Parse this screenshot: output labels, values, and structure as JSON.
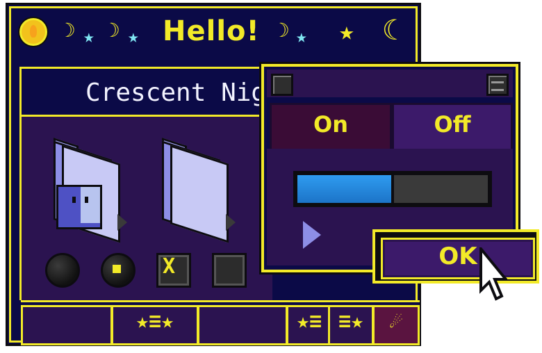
{
  "title_bar": {
    "title": "Hello!",
    "left_decorations": [
      "☽",
      "★",
      "☽",
      "★"
    ],
    "right_decorations": [
      "☽",
      "★",
      "★",
      "☾"
    ]
  },
  "panel": {
    "header": "Crescent Night"
  },
  "desktop_icons": [
    {
      "icon": "finder-folder-icon"
    },
    {
      "icon": "folder-icon"
    }
  ],
  "controls": {
    "radio_off": false,
    "radio_on": true,
    "checkbox_checked": true,
    "checkbox_unchecked": false,
    "check_glyph": "X"
  },
  "dialog": {
    "segments": [
      {
        "label": "On",
        "selected": true
      },
      {
        "label": "Off",
        "selected": false
      }
    ],
    "progress": 0.5,
    "ok_label": "OK"
  },
  "bottom_bar": {
    "cells": [
      "",
      "★≡★",
      "",
      "★≡",
      "≡★",
      "☄"
    ]
  },
  "colors": {
    "navy": "#0b0a47",
    "purple": "#2b1350",
    "yellow": "#f2ea28",
    "cyan": "#7fe6f2",
    "blue_fill": "#2f9cf0"
  }
}
